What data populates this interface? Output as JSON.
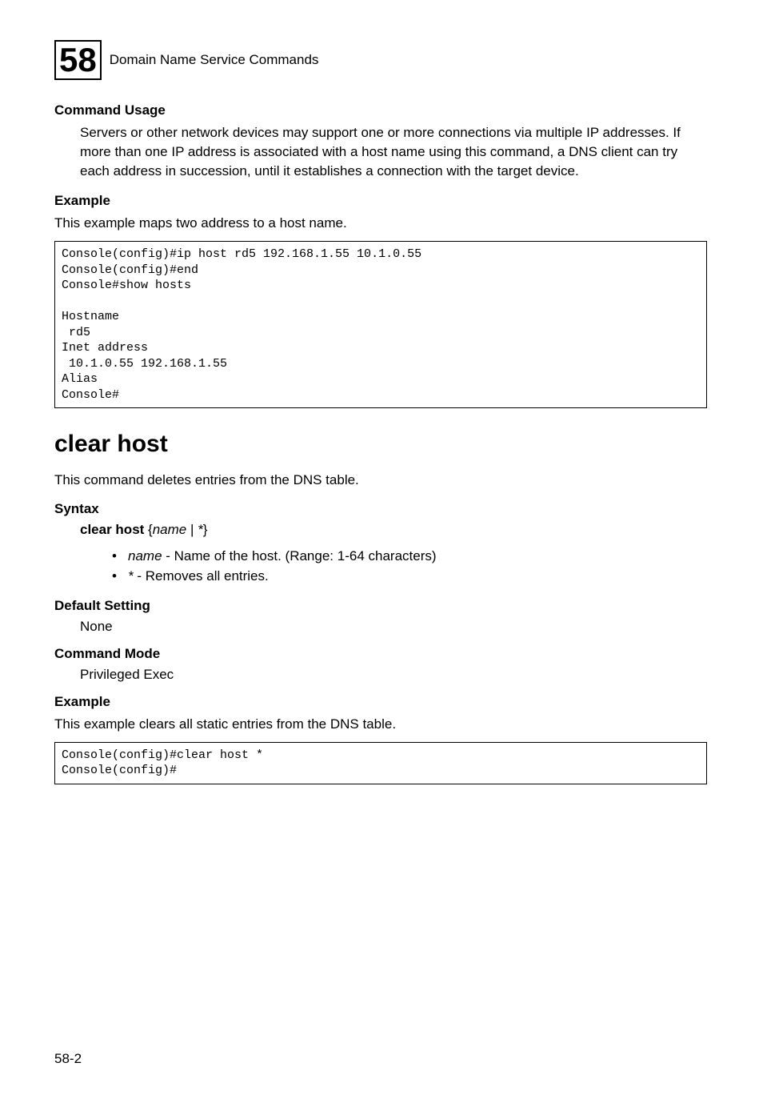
{
  "header": {
    "chapter_number": "58",
    "title": "Domain Name Service Commands"
  },
  "sections": {
    "command_usage": {
      "heading": "Command Usage",
      "text": "Servers or other network devices may support one or more connections via multiple IP addresses. If more than one IP address is associated with a host name using this command, a DNS client can try each address in succession, until it establishes a connection with the target device."
    },
    "example1": {
      "heading": "Example",
      "intro": "This example maps two address to a host name.",
      "code": "Console(config)#ip host rd5 192.168.1.55 10.1.0.55\nConsole(config)#end\nConsole#show hosts\n\nHostname\n rd5\nInet address\n 10.1.0.55 192.168.1.55\nAlias\nConsole#"
    },
    "clear_host_title": "clear host",
    "clear_host_desc": "This command deletes entries from the DNS table.",
    "syntax": {
      "heading": "Syntax",
      "command_bold": "clear host",
      "command_rest_open": " {",
      "command_italic1": "name",
      "command_mid": " | ",
      "command_italic2": "*",
      "command_close": "}",
      "bullet1_italic": "name",
      "bullet1_rest": " - Name of the host. (Range: 1-64 characters)",
      "bullet2_italic": "*",
      "bullet2_rest": " - Removes all entries."
    },
    "default_setting": {
      "heading": "Default Setting",
      "value": "None"
    },
    "command_mode": {
      "heading": "Command Mode",
      "value": "Privileged Exec"
    },
    "example2": {
      "heading": "Example",
      "intro": "This example clears all static entries from the DNS table.",
      "code": "Console(config)#clear host *\nConsole(config)#"
    }
  },
  "footer": {
    "page": "58-2"
  }
}
